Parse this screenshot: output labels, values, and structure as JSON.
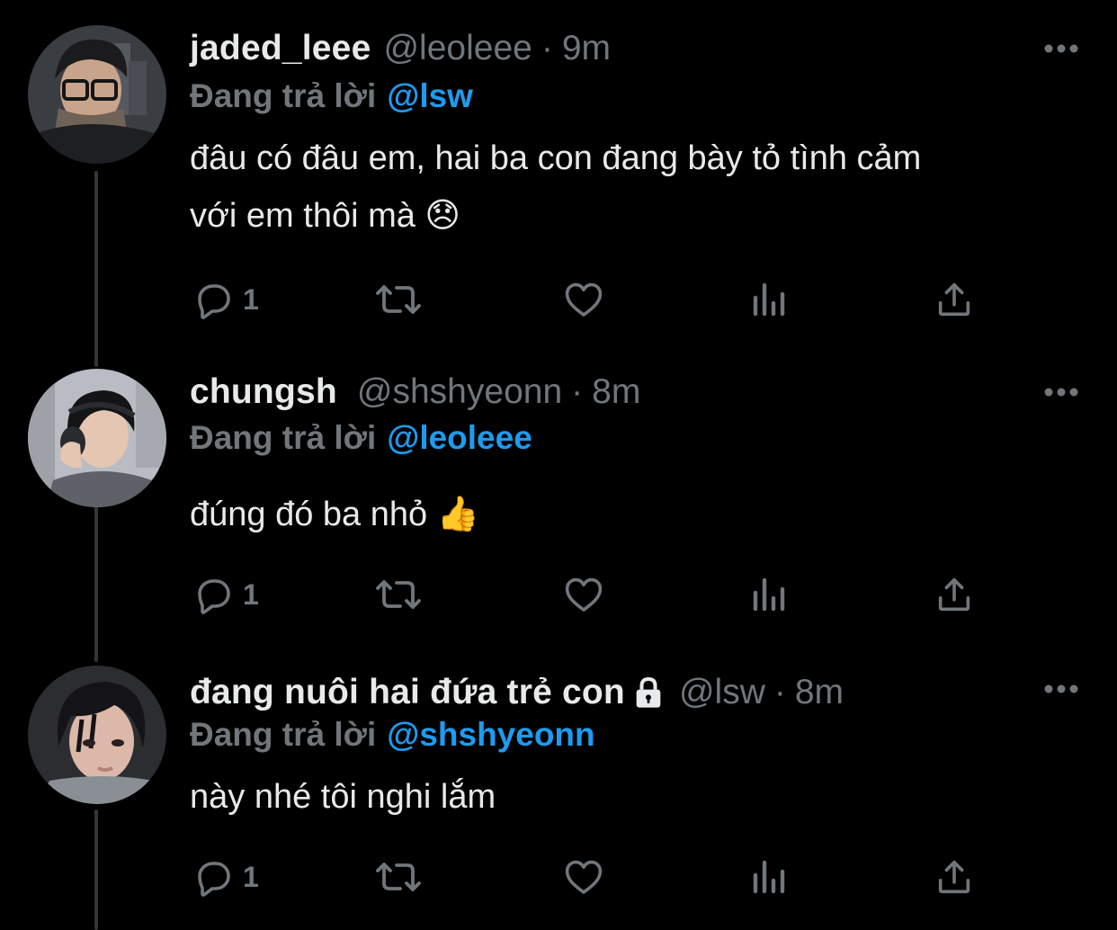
{
  "thread": {
    "tweets": [
      {
        "display_name": "jaded_leee",
        "handle": "@leoleee",
        "separator": "·",
        "time": "9m",
        "reply_prefix": "Đang trả lời",
        "reply_to": "@lsw",
        "text_line1": "đâu có đâu em, hai ba con đang bày tỏ tình cảm",
        "text_line2": "với em thôi mà 😞",
        "reply_count": "1",
        "protected": false,
        "avatar_colors": {
          "bg": "#3a3d42",
          "skin": "#c9a48c",
          "hair": "#1b1b1d",
          "accent": "#6f6256"
        }
      },
      {
        "display_name": "chungsh",
        "handle": "@shshyeonn",
        "separator": "·",
        "time": "8m",
        "reply_prefix": "Đang trả lời",
        "reply_to": "@leoleee",
        "text_line1": "đúng đó ba nhỏ 👍",
        "reply_count": "1",
        "protected": false,
        "avatar_colors": {
          "bg": "#b9bcc2",
          "skin": "#e4c6b3",
          "hair": "#141416",
          "accent": "#5f6168"
        }
      },
      {
        "display_name": "đang nuôi hai đứa trẻ con",
        "handle": "@lsw",
        "separator": "·",
        "time": "8m",
        "reply_prefix": "Đang trả lời",
        "reply_to": "@shshyeonn",
        "text_line1": "này nhé tôi nghi lắm",
        "reply_count": "1",
        "protected": true,
        "avatar_colors": {
          "bg": "#2c2d31",
          "skin": "#dcb8a8",
          "hair": "#141418",
          "accent": "#8a8f96"
        }
      }
    ]
  },
  "icons": {
    "reply": "reply-icon",
    "retweet": "retweet-icon",
    "like": "heart-icon",
    "views": "views-icon",
    "share": "share-icon",
    "more": "more-icon",
    "lock": "lock-icon"
  },
  "colors": {
    "background": "#000000",
    "text": "#e7e9ea",
    "muted": "#71767b",
    "link": "#1d9bf0",
    "thread_line": "#333639"
  }
}
